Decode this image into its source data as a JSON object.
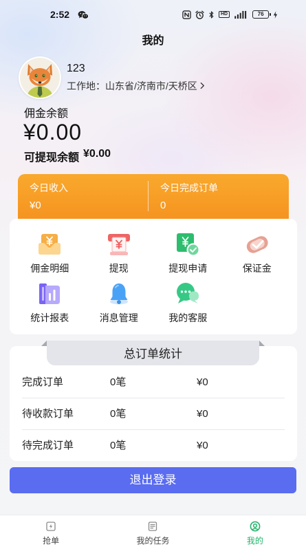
{
  "status_bar": {
    "time": "2:52",
    "hd_label": "HD",
    "battery": "76"
  },
  "header": {
    "title": "我的"
  },
  "profile": {
    "name": "123",
    "work_location": "工作地：山东省/济南市/天桥区"
  },
  "balance": {
    "label": "佣金余额",
    "amount": "¥0.00",
    "withdrawable_label": "可提现余额",
    "withdrawable_amount": "¥0.00"
  },
  "today": {
    "income_label": "今日收入",
    "income_value": "¥0",
    "orders_label": "今日完成订单",
    "orders_value": "0"
  },
  "grid": {
    "items": [
      {
        "label": "佣金明细",
        "icon": "commission-detail-icon"
      },
      {
        "label": "提现",
        "icon": "withdraw-icon"
      },
      {
        "label": "提现申请",
        "icon": "withdraw-apply-icon"
      },
      {
        "label": "保证金",
        "icon": "deposit-icon"
      },
      {
        "label": "统计报表",
        "icon": "report-icon"
      },
      {
        "label": "消息管理",
        "icon": "bell-icon"
      },
      {
        "label": "我的客服",
        "icon": "customer-service-icon"
      }
    ]
  },
  "order_stats": {
    "title": "总订单统计",
    "rows": [
      {
        "label": "完成订单",
        "count": "0笔",
        "amount": "¥0"
      },
      {
        "label": "待收款订单",
        "count": "0笔",
        "amount": "¥0"
      },
      {
        "label": "待完成订单",
        "count": "0笔",
        "amount": "¥0"
      }
    ]
  },
  "logout": {
    "label": "退出登录"
  },
  "bottom_nav": {
    "items": [
      {
        "label": "抢单",
        "icon": "grab-order-icon",
        "active": false
      },
      {
        "label": "我的任务",
        "icon": "task-list-icon",
        "active": false
      },
      {
        "label": "我的",
        "icon": "profile-icon",
        "active": true
      }
    ]
  },
  "theme": {
    "orange_top": "#f9a92d",
    "orange": "#f5911f",
    "button_blue": "#5a6cf0",
    "active_green": "#22b46a",
    "text": "#222222"
  }
}
